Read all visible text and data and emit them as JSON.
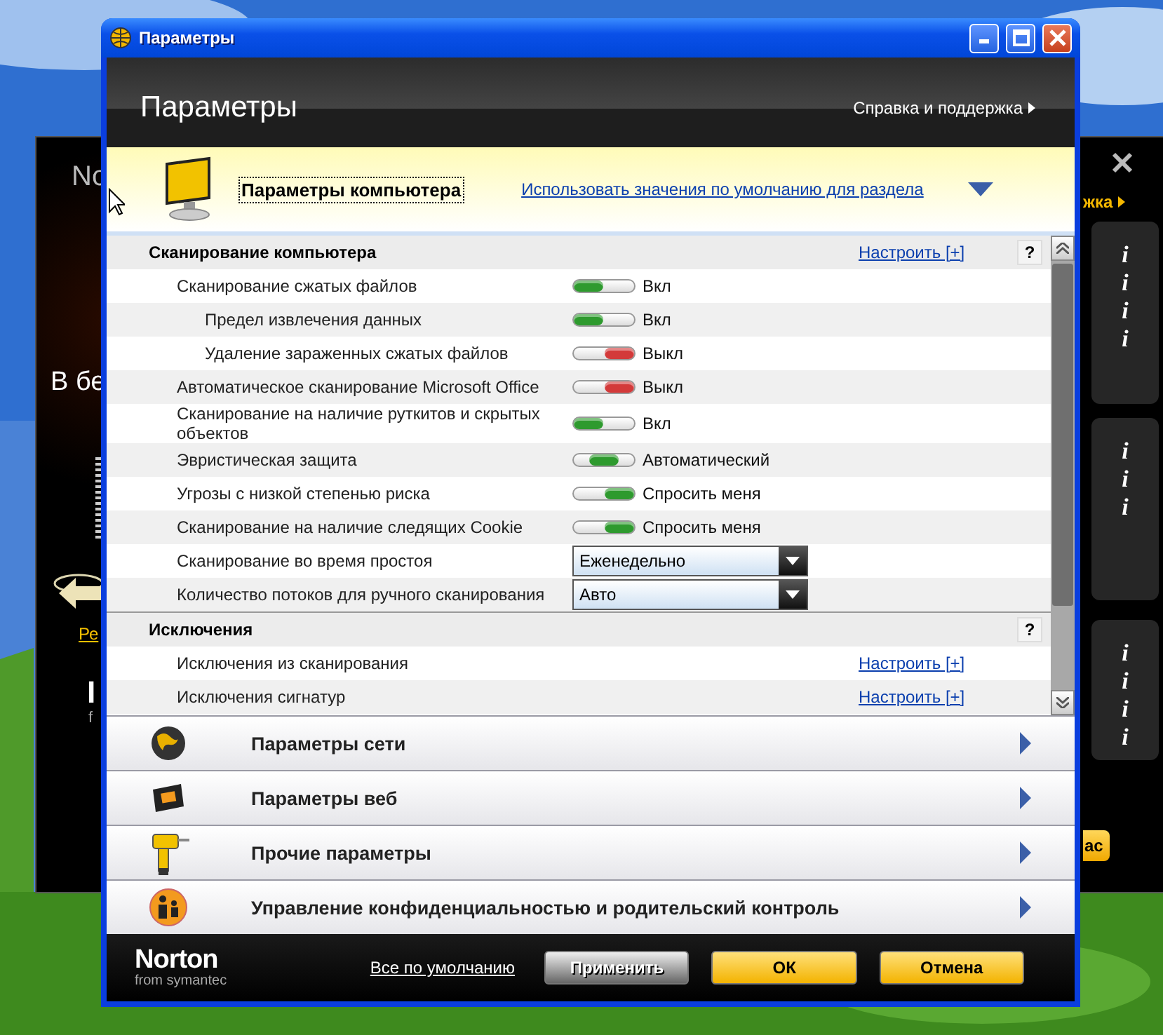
{
  "background_window": {
    "title_fragment": "No",
    "heading_fragment": "В бе",
    "link_fragment": "Ре",
    "logo_fragment": "I",
    "logo_subtitle_fragment": "f",
    "help_link_fragment": "жка",
    "button_fragment": "ас",
    "info_panels": [
      {
        "icons": [
          "i",
          "i",
          "i",
          "i"
        ]
      },
      {
        "icons": [
          "i",
          "i",
          "i"
        ]
      },
      {
        "icons": [
          "i",
          "i",
          "i",
          "i"
        ]
      }
    ]
  },
  "window": {
    "title": "Параметры"
  },
  "header": {
    "title": "Параметры",
    "help_link": "Справка и поддержка"
  },
  "category": {
    "kind": "computer",
    "title": "Параметры компьютера",
    "focused": true,
    "expanded": true,
    "defaults_link": "Использовать значения по умолчанию для раздела"
  },
  "sections": [
    {
      "title": "Сканирование компьютера",
      "link": "Настроить [+]",
      "help": "?",
      "rows": [
        {
          "label": "Сканирование сжатых файлов",
          "kind": "switch",
          "on": true,
          "value": "Вкл",
          "children": [
            {
              "label": "Предел извлечения данных",
              "kind": "switch",
              "on": true,
              "value": "Вкл"
            },
            {
              "label": "Удаление зараженных сжатых файлов",
              "kind": "switch",
              "on": false,
              "value": "Выкл"
            }
          ]
        },
        {
          "label": "Автоматическое сканирование Microsoft Office",
          "kind": "switch",
          "on": false,
          "value": "Выкл"
        },
        {
          "label": "Сканирование на наличие руткитов и скрытых объектов",
          "kind": "switch",
          "on": true,
          "value": "Вкл"
        },
        {
          "label": "Эвристическая защита",
          "kind": "auto_switch",
          "on": true,
          "value": "Автоматический"
        },
        {
          "label": "Угрозы с низкой степенью риска",
          "kind": "ask_switch",
          "on": true,
          "value": "Спросить меня"
        },
        {
          "label": "Сканирование на наличие следящих Cookie",
          "kind": "ask_switch",
          "on": true,
          "value": "Спросить меня"
        },
        {
          "label": "Сканирование во время простоя",
          "kind": "dropdown",
          "value": "Еженедельно"
        },
        {
          "label": "Количество потоков для ручного сканирования",
          "kind": "dropdown",
          "value": "Авто"
        }
      ]
    },
    {
      "title": "Исключения",
      "help": "?",
      "rows": [
        {
          "label": "Исключения из сканирования",
          "kind": "link",
          "value": "Настроить [+]"
        },
        {
          "label": "Исключения сигнатур",
          "kind": "link",
          "value": "Настроить [+]"
        }
      ]
    }
  ],
  "categories": [
    {
      "kind": "network",
      "title": "Параметры сети",
      "expanded": false
    },
    {
      "kind": "web",
      "title": "Параметры веб",
      "expanded": false
    },
    {
      "kind": "other",
      "title": "Прочие параметры",
      "expanded": false
    },
    {
      "kind": "family",
      "title": "Управление конфиденциальностью и родительский контроль",
      "expanded": false
    }
  ],
  "footer": {
    "logo": "Norton",
    "logo_subtitle": "from symantec",
    "defaults_link": "Все по умолчанию",
    "buttons": [
      {
        "label": "Применить",
        "kind": "secondary"
      },
      {
        "label": "ОК",
        "kind": "primary"
      },
      {
        "label": "Отмена",
        "kind": "primary"
      }
    ]
  }
}
